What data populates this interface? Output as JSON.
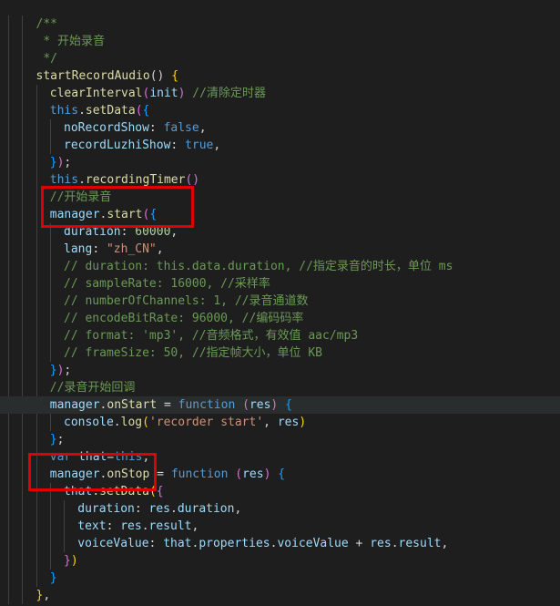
{
  "colors": {
    "background": "#1e1e1e",
    "comment": "#6a9955",
    "keyword": "#569cd6",
    "function": "#dcdcaa",
    "property": "#9cdcfe",
    "number": "#b5cea8",
    "string": "#ce9178",
    "annotation_box": "#e00000"
  },
  "editor": {
    "language": "javascript",
    "lines": [
      {
        "indent": 2,
        "tokens": [
          [
            "/**",
            "com"
          ]
        ]
      },
      {
        "indent": 2,
        "tokens": [
          [
            " * 开始录音",
            "com"
          ]
        ]
      },
      {
        "indent": 2,
        "tokens": [
          [
            " */",
            "com"
          ]
        ]
      },
      {
        "indent": 2,
        "tokens": [
          [
            "startRecordAudio",
            "fn"
          ],
          [
            "() ",
            "punc"
          ],
          [
            "{",
            "br1"
          ]
        ]
      },
      {
        "indent": 3,
        "tokens": [
          [
            "clearInterval",
            "fn"
          ],
          [
            "(",
            "br2"
          ],
          [
            "init",
            "var"
          ],
          [
            ")",
            "br2"
          ],
          [
            " ",
            "punc"
          ],
          [
            "//清除定时器",
            "com"
          ]
        ]
      },
      {
        "indent": 3,
        "tokens": [
          [
            "this",
            "blue"
          ],
          [
            ".",
            "punc"
          ],
          [
            "setData",
            "fn"
          ],
          [
            "(",
            "br2"
          ],
          [
            "{",
            "br3"
          ]
        ]
      },
      {
        "indent": 4,
        "tokens": [
          [
            "noRecordShow",
            "prop"
          ],
          [
            ": ",
            "punc"
          ],
          [
            "false",
            "blue"
          ],
          [
            ",",
            "punc"
          ]
        ]
      },
      {
        "indent": 4,
        "tokens": [
          [
            "recordLuzhiShow",
            "prop"
          ],
          [
            ": ",
            "punc"
          ],
          [
            "true",
            "blue"
          ],
          [
            ",",
            "punc"
          ]
        ]
      },
      {
        "indent": 3,
        "tokens": [
          [
            "}",
            "br3"
          ],
          [
            ")",
            "br2"
          ],
          [
            ";",
            "punc"
          ]
        ]
      },
      {
        "indent": 3,
        "tokens": [
          [
            "this",
            "blue"
          ],
          [
            ".",
            "punc"
          ],
          [
            "recordingTimer",
            "fn"
          ],
          [
            "()",
            "br2"
          ]
        ]
      },
      {
        "indent": 3,
        "tokens": [
          [
            "//开始录音",
            "com"
          ]
        ]
      },
      {
        "indent": 3,
        "tokens": [
          [
            "manager",
            "var"
          ],
          [
            ".",
            "punc"
          ],
          [
            "start",
            "fn"
          ],
          [
            "(",
            "br2"
          ],
          [
            "{",
            "br3"
          ]
        ]
      },
      {
        "indent": 4,
        "tokens": [
          [
            "duration",
            "prop"
          ],
          [
            ": ",
            "punc"
          ],
          [
            "60000",
            "num"
          ],
          [
            ",",
            "punc"
          ]
        ]
      },
      {
        "indent": 4,
        "tokens": [
          [
            "lang",
            "prop"
          ],
          [
            ": ",
            "punc"
          ],
          [
            "\"zh_CN\"",
            "str"
          ],
          [
            ",",
            "punc"
          ]
        ]
      },
      {
        "indent": 4,
        "tokens": [
          [
            "// duration: this.data.duration, //指定录音的时长，单位 ms",
            "com"
          ]
        ]
      },
      {
        "indent": 4,
        "tokens": [
          [
            "// sampleRate: 16000, //采样率",
            "com"
          ]
        ]
      },
      {
        "indent": 4,
        "tokens": [
          [
            "// numberOfChannels: 1, //录音通道数",
            "com"
          ]
        ]
      },
      {
        "indent": 4,
        "tokens": [
          [
            "// encodeBitRate: 96000, //编码码率",
            "com"
          ]
        ]
      },
      {
        "indent": 4,
        "tokens": [
          [
            "// format: 'mp3', //音频格式，有效值 aac/mp3",
            "com"
          ]
        ]
      },
      {
        "indent": 4,
        "tokens": [
          [
            "// frameSize: 50, //指定帧大小，单位 KB",
            "com"
          ]
        ]
      },
      {
        "indent": 3,
        "tokens": [
          [
            "}",
            "br3"
          ],
          [
            ")",
            "br2"
          ],
          [
            ";",
            "punc"
          ]
        ]
      },
      {
        "indent": 3,
        "tokens": [
          [
            "//录音开始回调",
            "com"
          ]
        ]
      },
      {
        "indent": 3,
        "highlight": true,
        "tokens": [
          [
            "manager",
            "var"
          ],
          [
            ".",
            "punc"
          ],
          [
            "onStart",
            "fn"
          ],
          [
            " = ",
            "punc"
          ],
          [
            "function",
            "blue"
          ],
          [
            " ",
            "punc"
          ],
          [
            "(",
            "br2"
          ],
          [
            "res",
            "var"
          ],
          [
            ")",
            "br2"
          ],
          [
            " ",
            "punc"
          ],
          [
            "{",
            "br3"
          ]
        ]
      },
      {
        "indent": 4,
        "tokens": [
          [
            "console",
            "var"
          ],
          [
            ".",
            "punc"
          ],
          [
            "log",
            "fn"
          ],
          [
            "(",
            "br1"
          ],
          [
            "'recorder start'",
            "str"
          ],
          [
            ", ",
            "punc"
          ],
          [
            "res",
            "var"
          ],
          [
            ")",
            "br1"
          ]
        ]
      },
      {
        "indent": 3,
        "tokens": [
          [
            "}",
            "br3"
          ],
          [
            ";",
            "punc"
          ]
        ]
      },
      {
        "indent": 3,
        "tokens": [
          [
            "var",
            "blue"
          ],
          [
            " ",
            "punc"
          ],
          [
            "that",
            "var"
          ],
          [
            "=",
            "punc"
          ],
          [
            "this",
            "blue"
          ],
          [
            ",",
            "punc"
          ]
        ]
      },
      {
        "indent": 3,
        "tokens": [
          [
            "manager",
            "var"
          ],
          [
            ".",
            "punc"
          ],
          [
            "onStop",
            "fn"
          ],
          [
            " = ",
            "punc"
          ],
          [
            "function",
            "blue"
          ],
          [
            " ",
            "punc"
          ],
          [
            "(",
            "br2"
          ],
          [
            "res",
            "var"
          ],
          [
            ")",
            "br2"
          ],
          [
            " ",
            "punc"
          ],
          [
            "{",
            "br3"
          ]
        ]
      },
      {
        "indent": 4,
        "tokens": [
          [
            "that",
            "var"
          ],
          [
            ".",
            "punc"
          ],
          [
            "setData",
            "fn"
          ],
          [
            "(",
            "br1"
          ],
          [
            "{",
            "br2"
          ]
        ]
      },
      {
        "indent": 5,
        "tokens": [
          [
            "duration",
            "prop"
          ],
          [
            ": ",
            "punc"
          ],
          [
            "res",
            "var"
          ],
          [
            ".",
            "punc"
          ],
          [
            "duration",
            "prop"
          ],
          [
            ",",
            "punc"
          ]
        ]
      },
      {
        "indent": 5,
        "tokens": [
          [
            "text",
            "prop"
          ],
          [
            ": ",
            "punc"
          ],
          [
            "res",
            "var"
          ],
          [
            ".",
            "punc"
          ],
          [
            "result",
            "prop"
          ],
          [
            ",",
            "punc"
          ]
        ]
      },
      {
        "indent": 5,
        "tokens": [
          [
            "voiceValue",
            "prop"
          ],
          [
            ": ",
            "punc"
          ],
          [
            "that",
            "var"
          ],
          [
            ".",
            "punc"
          ],
          [
            "properties",
            "prop"
          ],
          [
            ".",
            "punc"
          ],
          [
            "voiceValue",
            "prop"
          ],
          [
            " + ",
            "punc"
          ],
          [
            "res",
            "var"
          ],
          [
            ".",
            "punc"
          ],
          [
            "result",
            "prop"
          ],
          [
            ",",
            "punc"
          ]
        ]
      },
      {
        "indent": 4,
        "tokens": [
          [
            "}",
            "br2"
          ],
          [
            ")",
            "br1"
          ]
        ]
      },
      {
        "indent": 3,
        "tokens": [
          [
            "}",
            "br3"
          ]
        ]
      },
      {
        "indent": 2,
        "tokens": [
          [
            "}",
            "br1"
          ],
          [
            ",",
            "punc"
          ]
        ]
      }
    ]
  }
}
